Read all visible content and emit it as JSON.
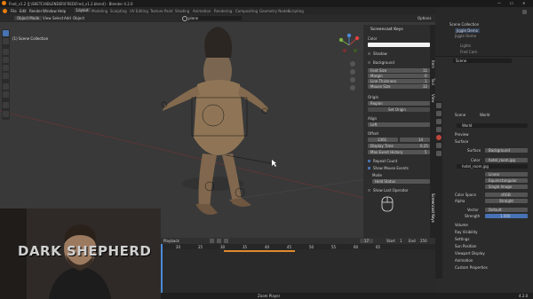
{
  "titlebar": {
    "path": "Fred_v1.2 [J:\\SKETCH\\BLENDER\\FRED\\Fred_v1.2.blend] - Blender 4.2.0"
  },
  "menubar": {
    "items": [
      "File",
      "Edit",
      "Render",
      "Window",
      "Help"
    ],
    "workspaces": [
      "Layout",
      "Modeling",
      "Sculpting",
      "UV Editing",
      "Texture Paint",
      "Shading",
      "Animation",
      "Rendering",
      "Compositing",
      "Geometry Nodes",
      "Scripting"
    ],
    "scene_label": "Scene",
    "viewlayer_label": "View Layer"
  },
  "toolbar": {
    "mode": "Object Mode",
    "view": "View",
    "select": "Select",
    "add": "Add",
    "object": "Object",
    "search": "plane",
    "options": "Options"
  },
  "viewport": {
    "collection_label": "(1) Scene Collection"
  },
  "npanel": {
    "title": "Screencast Keys",
    "color_label": "Color",
    "shadow_label": "Shadow",
    "background_label": "Background",
    "font_size_label": "Font Size",
    "font_size_value": "11",
    "margin_label": "Margin",
    "margin_value": "0",
    "line_thickness_label": "Line Thickness",
    "line_thickness_value": "1",
    "mouse_size_label": "Mouse Size",
    "mouse_size_value": "32",
    "origin_label": "Origin",
    "origin_value": "Region",
    "set_origin": "Set Origin",
    "align_label": "Align",
    "align_value": "Left",
    "offset_label": "Offset",
    "offset_x": "1361",
    "offset_y": "14",
    "display_time_label": "Display Time",
    "display_time_value": "0.25",
    "max_event_history_label": "Max Event History",
    "max_event_history_value": "5",
    "repeat_count_label": "Repeat Count",
    "show_mouse_events_label": "Show Mouse Events",
    "mode_label": "Mode",
    "mode_value": "Hold Status",
    "show_last_operator_label": "Show Last Operator",
    "tabs": [
      "Item",
      "Tool",
      "View",
      "Screencast Keys"
    ]
  },
  "outliner": {
    "title": "Scene Collection",
    "items": [
      "Jiggle Demo",
      "Jiggle Demo",
      "Lights",
      "Fred Cam"
    ]
  },
  "properties": {
    "search": "Scene",
    "world_label": "World",
    "world_name": "World",
    "preview_label": "Preview",
    "surface_label": "Surface",
    "surface_field": "Surface",
    "surface_value": "Background",
    "color_label": "Color",
    "color_value": "hotel_room.jpg",
    "image_name": "hotel_room.jpg",
    "interp_value": "Linear",
    "projection_value": "Equirectangular",
    "single_image": "Single Image",
    "color_space_label": "Color Space",
    "color_space_value": "sRGB",
    "alpha_label": "Alpha",
    "alpha_value": "Straight",
    "vector_label": "Vector",
    "vector_value": "Default",
    "strength_label": "Strength",
    "strength_value": "1.000",
    "sections": [
      "Volume",
      "Ray Visibility",
      "Settings",
      "Sun Position",
      "Viewport Display",
      "Animation",
      "Custom Properties"
    ]
  },
  "timeline": {
    "playback": "Playback",
    "keying": "Keying",
    "view": "View",
    "marker": "Marker",
    "current_frame": "17",
    "start_label": "Start",
    "start_value": "1",
    "end_label": "End",
    "end_value": "250",
    "ticks": [
      "20",
      "25",
      "30",
      "35",
      "40",
      "45",
      "50",
      "55",
      "60",
      "65"
    ]
  },
  "status": {
    "hint": "Zoom Player",
    "version": "4.2.0"
  },
  "webcam": {
    "logo": "DARK SHEPHERD"
  },
  "colors": {
    "accent": "#4772b3",
    "keyframe_bar": "#e08a2c",
    "playhead": "#4b8bd8"
  }
}
